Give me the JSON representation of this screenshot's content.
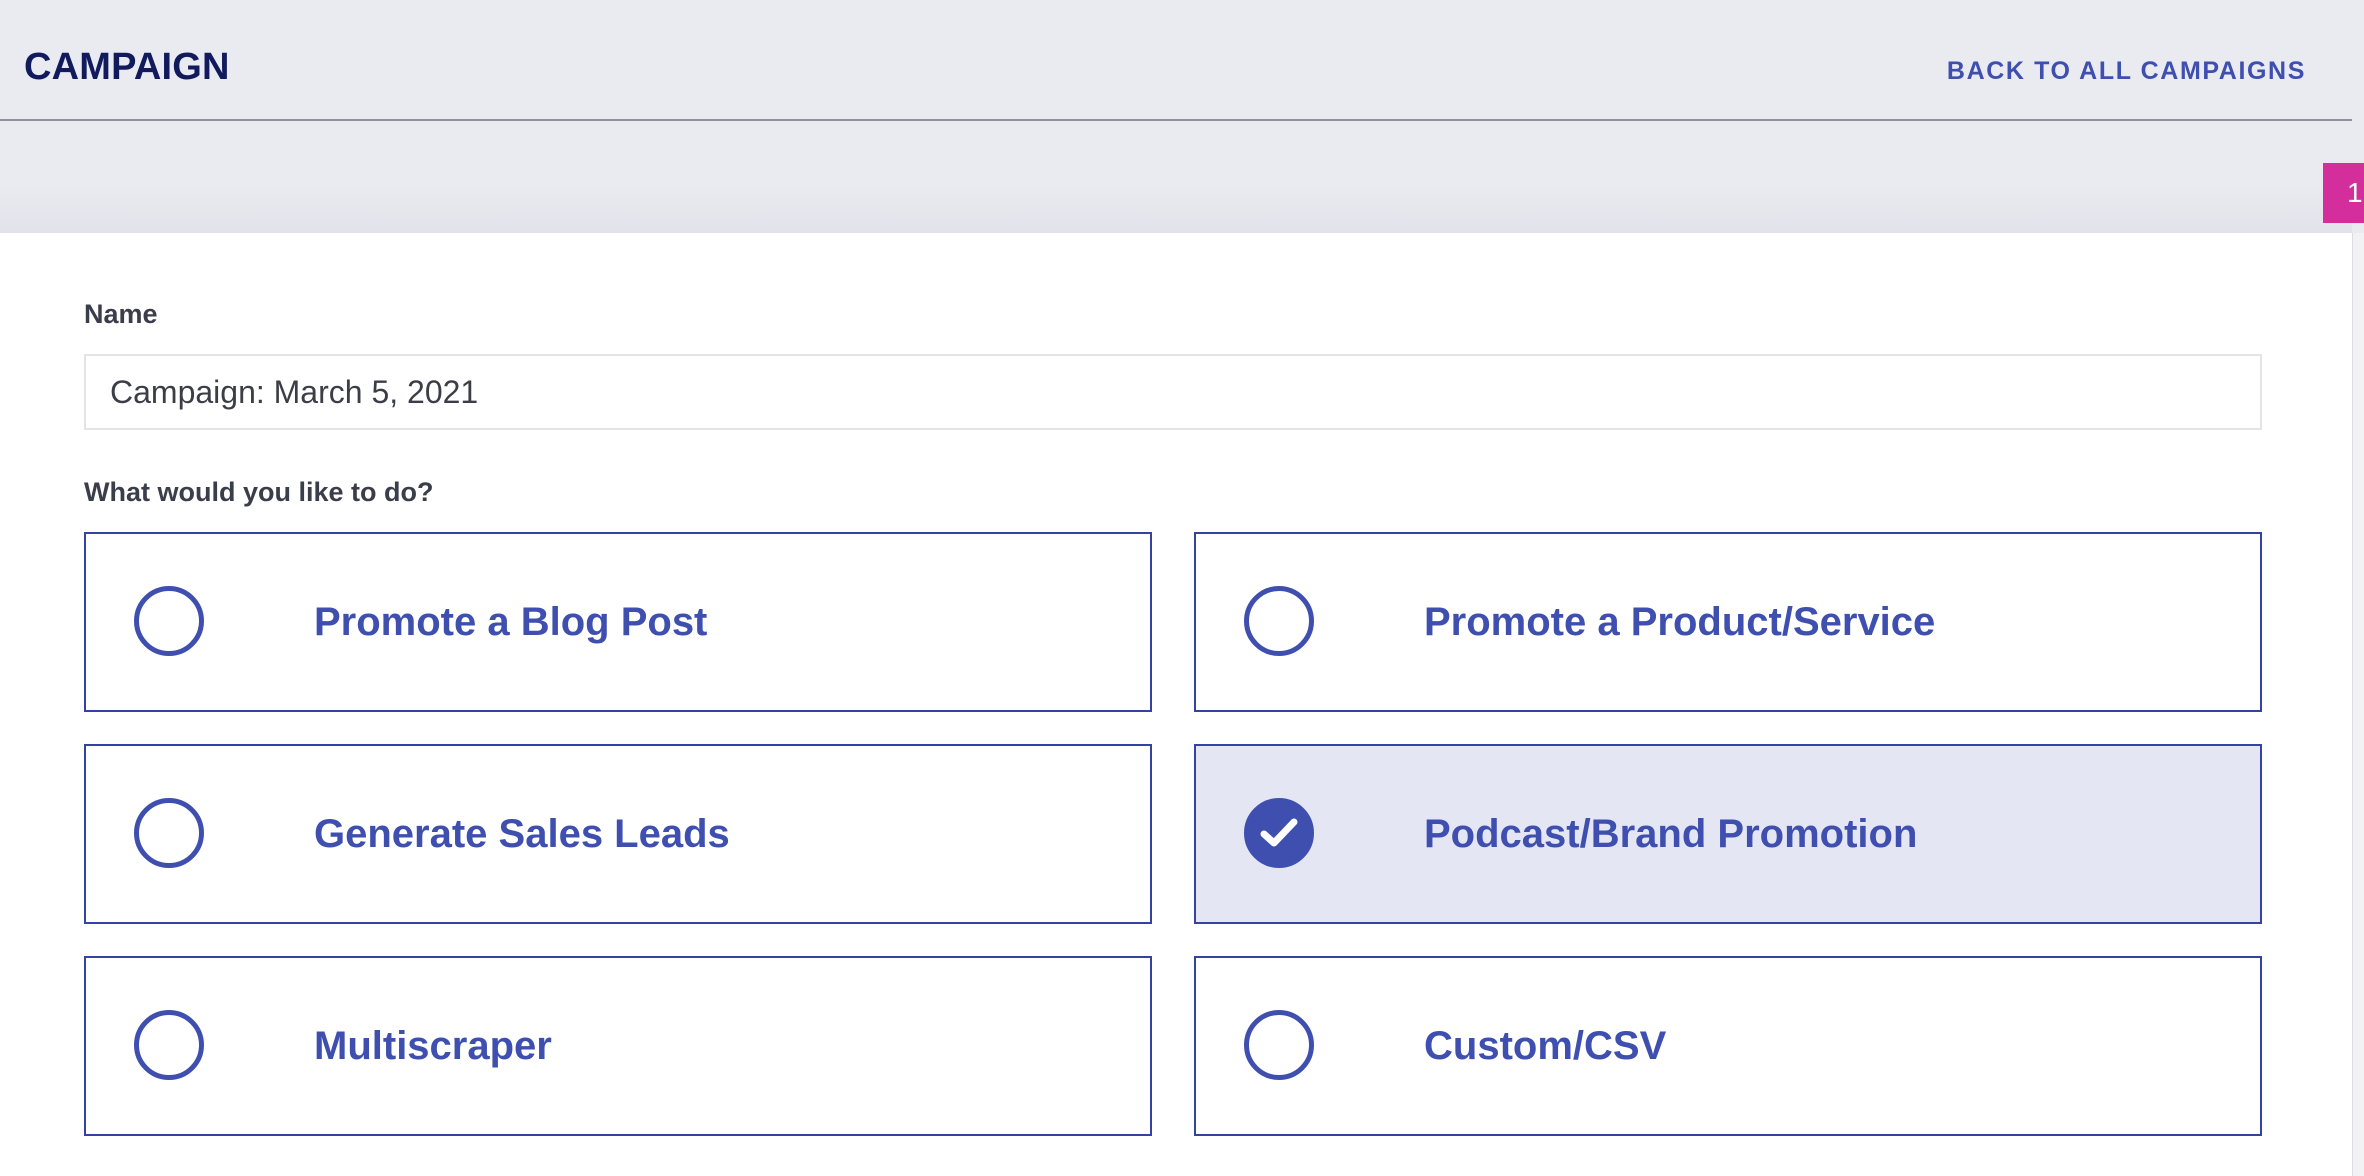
{
  "header": {
    "title": "CAMPAIGN",
    "back_link": "BACK TO ALL CAMPAIGNS"
  },
  "step_badge": "1",
  "form": {
    "name_label": "Name",
    "name_value": "Campaign: March 5, 2021",
    "question": "What would you like to do?",
    "options": [
      {
        "label": "Promote a Blog Post",
        "selected": false
      },
      {
        "label": "Promote a Product/Service",
        "selected": false
      },
      {
        "label": "Generate Sales Leads",
        "selected": false
      },
      {
        "label": "Podcast/Brand Promotion",
        "selected": true
      },
      {
        "label": "Multiscraper",
        "selected": false
      },
      {
        "label": "Custom/CSV",
        "selected": false
      }
    ]
  },
  "icons": {
    "unselected": "radio-empty-icon",
    "selected": "check-circle-icon"
  },
  "colors": {
    "accent": "#3f4fb0",
    "title": "#101a5c",
    "badge": "#d32e9c",
    "selected_bg": "#e4e6f3"
  }
}
